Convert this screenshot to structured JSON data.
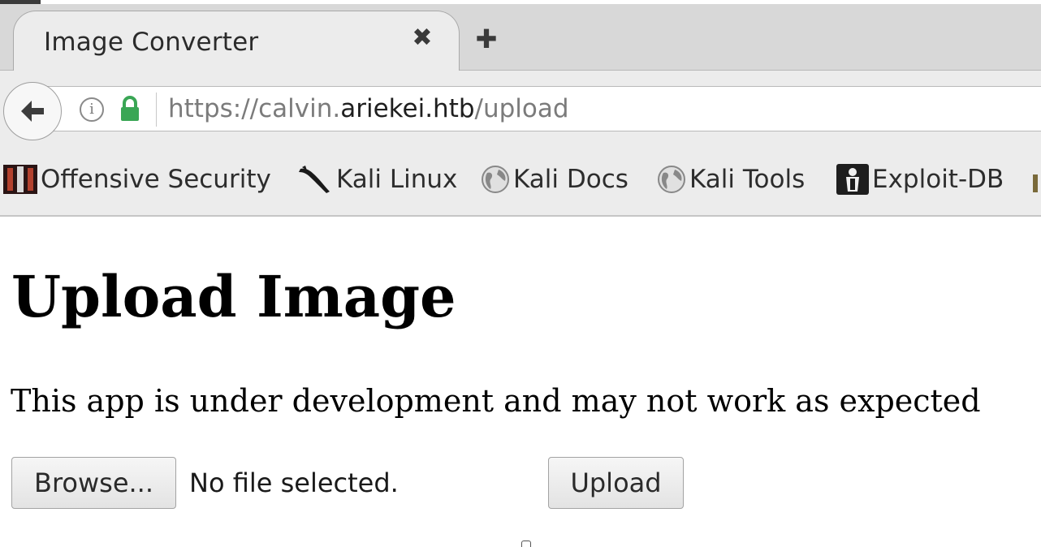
{
  "browser": {
    "tab": {
      "title": "Image Converter",
      "close_glyph": "✖",
      "close_icon": "close-icon"
    },
    "new_tab_glyph": "✚",
    "nav": {
      "back_icon": "back-arrow-icon",
      "info_icon": "info-icon",
      "lock_icon": "lock-icon",
      "lock_color": "#3aa655",
      "url": {
        "prefix": "https://calvin.",
        "host": "ariekei.htb",
        "path": "/upload"
      }
    },
    "bookmarks": [
      {
        "label": "Offensive Security",
        "icon": "offsec-icon"
      },
      {
        "label": "Kali Linux",
        "icon": "kali-dragon-icon"
      },
      {
        "label": "Kali Docs",
        "icon": "globe-icon"
      },
      {
        "label": "Kali Tools",
        "icon": "globe-icon"
      },
      {
        "label": "Exploit-DB",
        "icon": "exploit-db-icon"
      }
    ]
  },
  "page": {
    "title": "Upload Image",
    "subtitle": "This app is under development and may not work as expected",
    "form": {
      "browse_label": "Browse...",
      "file_status": "No file selected.",
      "upload_label": "Upload"
    }
  }
}
